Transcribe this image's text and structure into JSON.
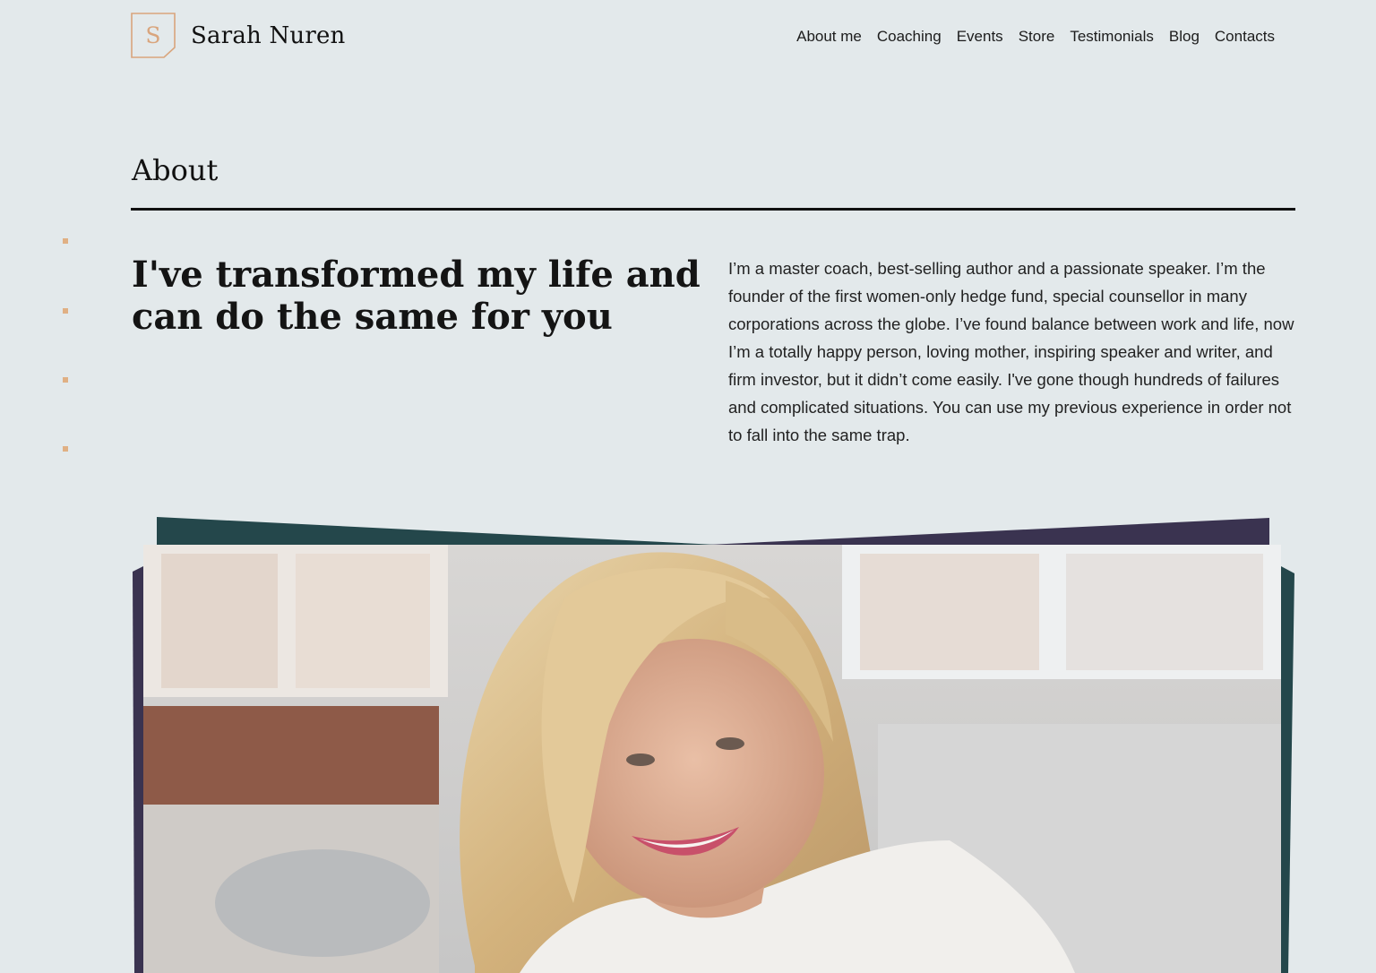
{
  "brand": {
    "logo_letter": "S",
    "name": "Sarah Nuren",
    "accent_color": "#d9a57d"
  },
  "nav": {
    "items": [
      {
        "label": "About me"
      },
      {
        "label": "Coaching"
      },
      {
        "label": "Events"
      },
      {
        "label": "Store"
      },
      {
        "label": "Testimonials"
      },
      {
        "label": "Blog"
      },
      {
        "label": "Contacts"
      }
    ]
  },
  "about": {
    "title": "About",
    "headline": "I've transformed my life and can do the same for you",
    "bio": "I’m a master coach, best-selling author and a passionate speaker. I’m the founder of the first women-only hedge fund, special counsellor in many corporations across the globe. I’ve found balance between work and life, now I’m a totally happy person, loving mother, inspiring speaker and writer, and firm investor, but it didn’t come easily. I've gone though hundreds of failures and complicated situations. You can use my previous experience in order not to fall into the same trap."
  },
  "photo": {
    "icon": "portrait-photo",
    "frame_colors": [
      "#24474b",
      "#3a3350"
    ]
  },
  "colors": {
    "background": "#e3e9eb",
    "text": "#111111",
    "accent": "#e0b084"
  }
}
